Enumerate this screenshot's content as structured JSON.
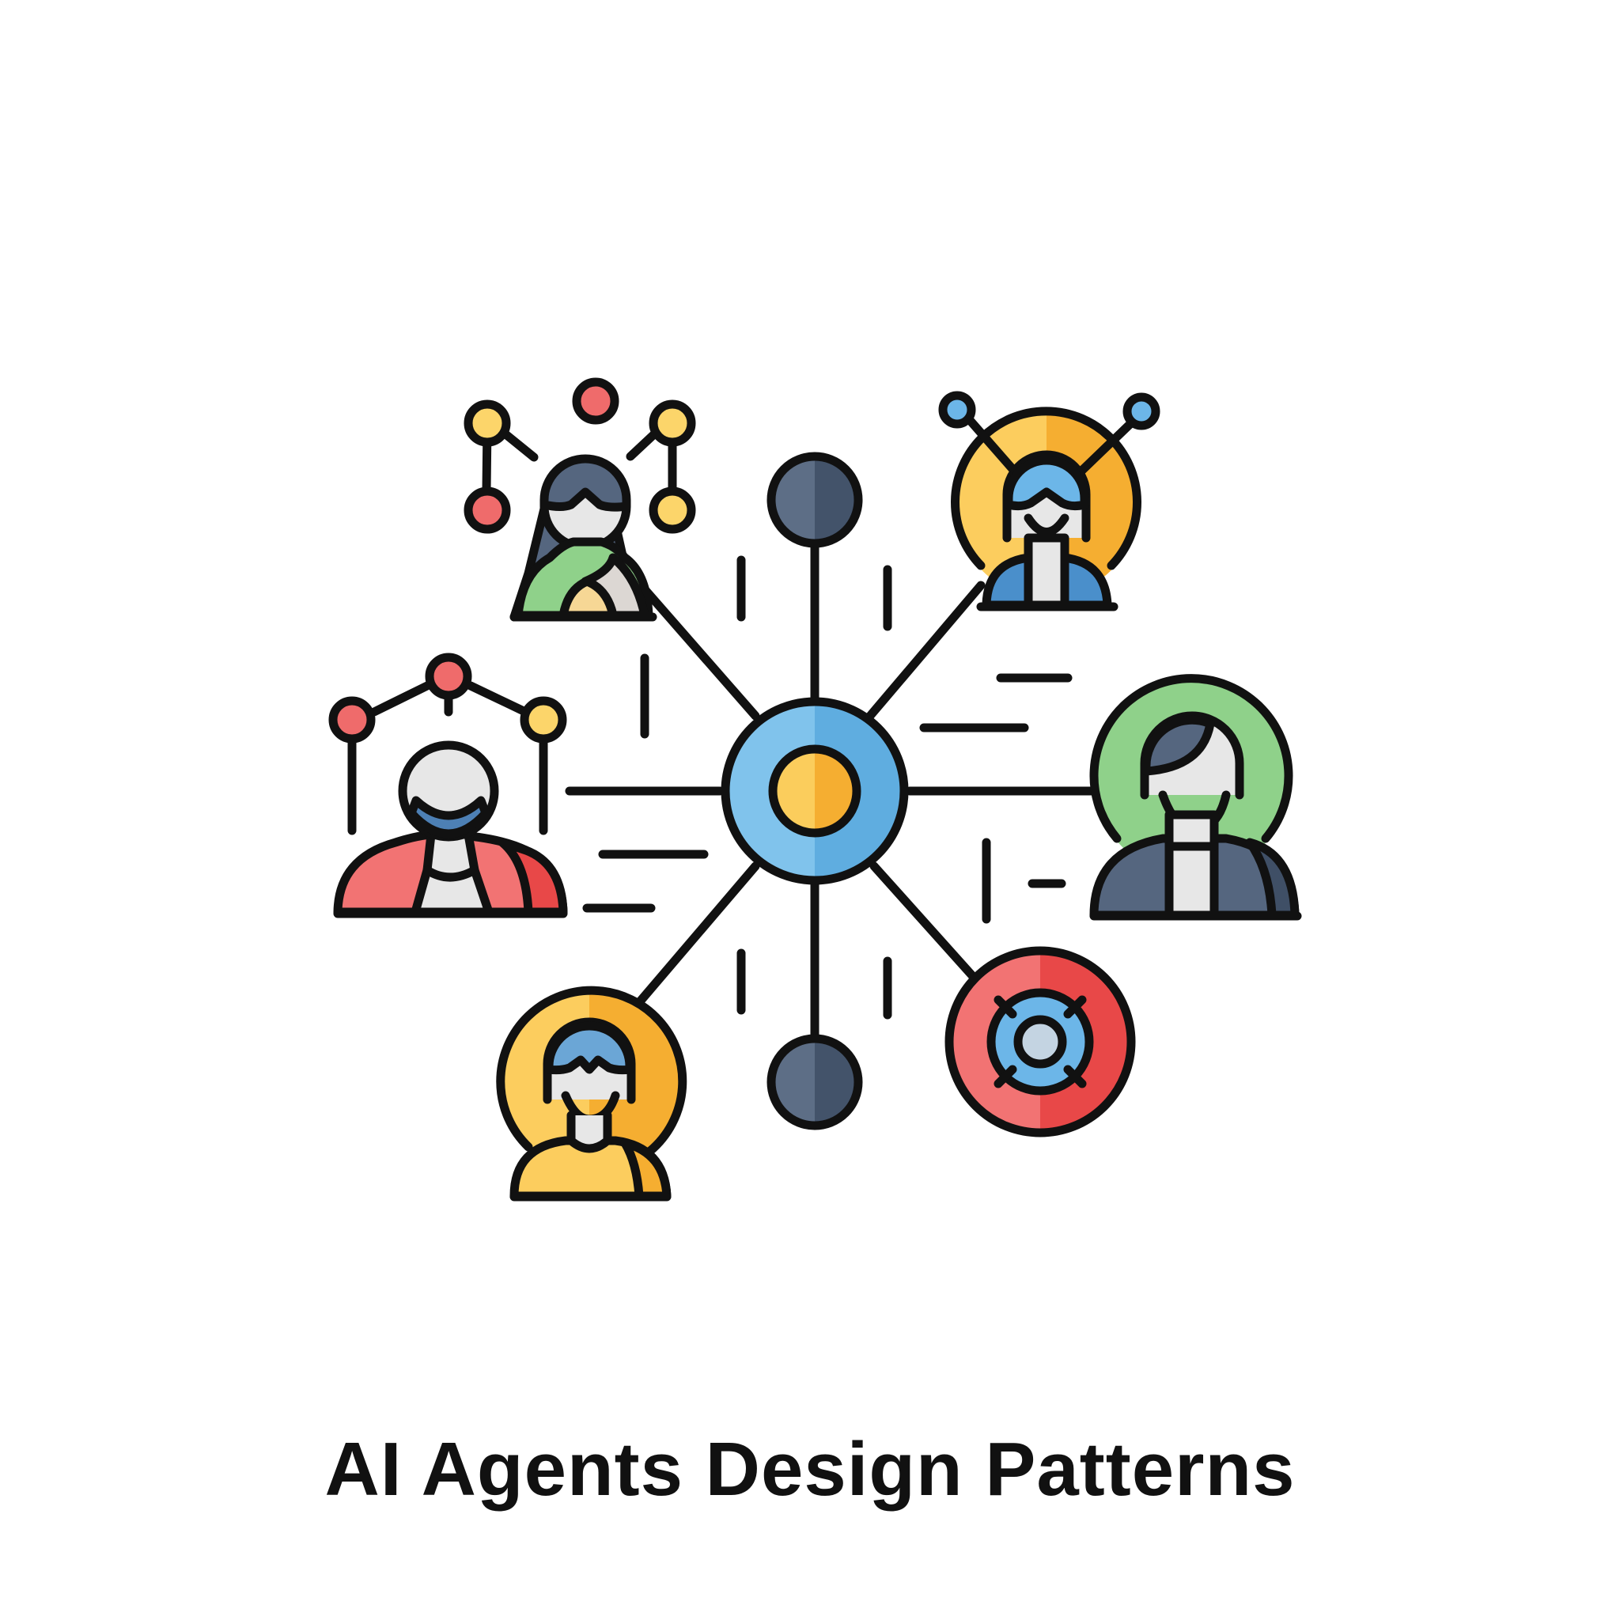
{
  "caption": "AI Agents Design Patterns",
  "colors": {
    "outline": "#111111",
    "background": "#ffffff",
    "blue": "#6cb6e8",
    "blue_dark": "#4a8fcb",
    "yellow": "#fbcd5c",
    "orange": "#f5ae31",
    "red": "#ef6b6b",
    "red_dark": "#e84848",
    "green": "#8fd18a",
    "slate": "#55667f",
    "slate_dark": "#3f4f66",
    "face": "#e7e7e7",
    "steel": "#c4d4e2"
  },
  "icons": {
    "hub": "central-hub-icon",
    "agents": [
      "agent-woman-network-icon",
      "agent-robot-antenna-icon",
      "agent-man-network-icon",
      "agent-businessman-icon",
      "agent-person-yellow-icon",
      "target-icon"
    ]
  }
}
